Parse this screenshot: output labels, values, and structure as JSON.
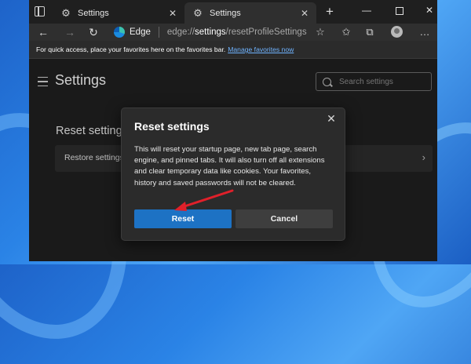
{
  "tabs": [
    {
      "title": "Settings",
      "close": "✕"
    },
    {
      "title": "Settings",
      "close": "✕"
    }
  ],
  "new_tab": "+",
  "window_controls": {
    "minimize": "—",
    "close": "✕"
  },
  "toolbar": {
    "back": "←",
    "forward": "→",
    "reload": "↻",
    "browser_name": "Edge",
    "url_prefix": "edge://",
    "url_strong": "settings",
    "url_suffix": "/resetProfileSettings",
    "favorite_star": "☆",
    "favorites_icon": "✩",
    "collections_icon": "⧉",
    "extensions_icon": "⚙",
    "more": "…"
  },
  "favorites_bar": {
    "text": "For quick access, place your favorites here on the favorites bar.",
    "link": "Manage favorites now"
  },
  "settings": {
    "title": "Settings",
    "search_placeholder": "Search settings",
    "section_heading": "Reset setting",
    "restore_label": "Restore settings",
    "restore_chevron": "›"
  },
  "dialog": {
    "title": "Reset settings",
    "close": "✕",
    "body": "This will reset your startup page, new tab page, search engine, and pinned tabs. It will also turn off all extensions and clear temporary data like cookies. Your favorites, history and saved passwords will not be cleared.",
    "reset_label": "Reset",
    "cancel_label": "Cancel"
  },
  "colors": {
    "accent": "#1d72c4",
    "annotation_arrow": "#e0202a"
  }
}
